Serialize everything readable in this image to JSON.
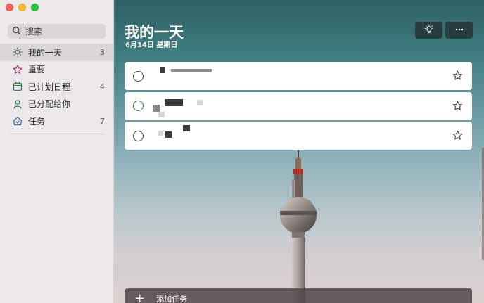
{
  "sidebar": {
    "search": {
      "placeholder": "搜索"
    },
    "items": [
      {
        "label": "我的一天",
        "count": "3",
        "icon": "sun-icon",
        "icon_color": "#555555",
        "active": true
      },
      {
        "label": "重要",
        "count": "",
        "icon": "star-icon",
        "icon_color": "#a8356b"
      },
      {
        "label": "已计划日程",
        "count": "4",
        "icon": "calendar-icon",
        "icon_color": "#2f7a4f"
      },
      {
        "label": "已分配给你",
        "count": "",
        "icon": "person-icon",
        "icon_color": "#2f7a4f"
      },
      {
        "label": "任务",
        "count": "7",
        "icon": "home-icon",
        "icon_color": "#4b5fb0"
      }
    ]
  },
  "header": {
    "title": "我的一天",
    "date": "6月14日 星期日"
  },
  "tasks": [
    {
      "title": ""
    },
    {
      "title": ""
    },
    {
      "title": ""
    }
  ],
  "add_task": {
    "placeholder": "添加任务"
  },
  "colors": {
    "accent_green": "#2f7a4f",
    "important_red": "#a8356b",
    "task_blue": "#4b5fb0"
  }
}
